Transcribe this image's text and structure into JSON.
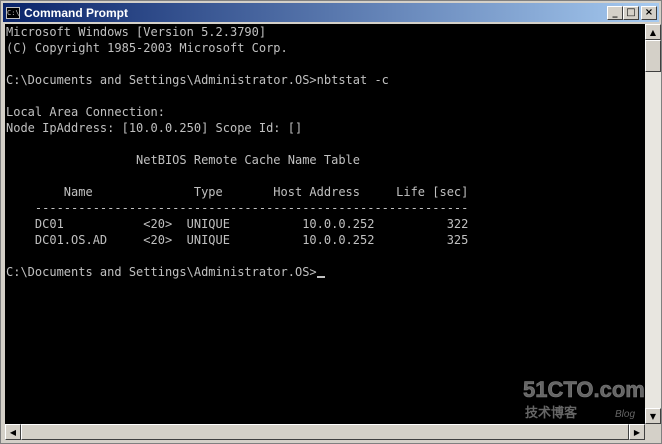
{
  "window": {
    "title": "Command Prompt",
    "minimize_glyph": "_",
    "maximize_glyph": "□",
    "close_glyph": "×",
    "system_icon_text": "C:\\"
  },
  "console": {
    "lines": [
      "Microsoft Windows [Version 5.2.3790]",
      "(C) Copyright 1985-2003 Microsoft Corp.",
      "",
      "C:\\Documents and Settings\\Administrator.OS>nbtstat -c",
      "",
      "Local Area Connection:",
      "Node IpAddress: [10.0.0.250] Scope Id: []",
      "",
      "                  NetBIOS Remote Cache Name Table",
      "",
      "        Name              Type       Host Address     Life [sec]",
      "    ------------------------------------------------------------",
      "    DC01           <20>  UNIQUE          10.0.0.252          322",
      "    DC01.OS.AD     <20>  UNIQUE          10.0.0.252          325",
      "",
      "C:\\Documents and Settings\\Administrator.OS>"
    ]
  },
  "scrollbar": {
    "up_glyph": "▲",
    "down_glyph": "▼",
    "left_glyph": "◀",
    "right_glyph": "▶"
  },
  "watermark": {
    "brand": "51CTO.com",
    "sub": "技术博客",
    "tag": "Blog"
  }
}
